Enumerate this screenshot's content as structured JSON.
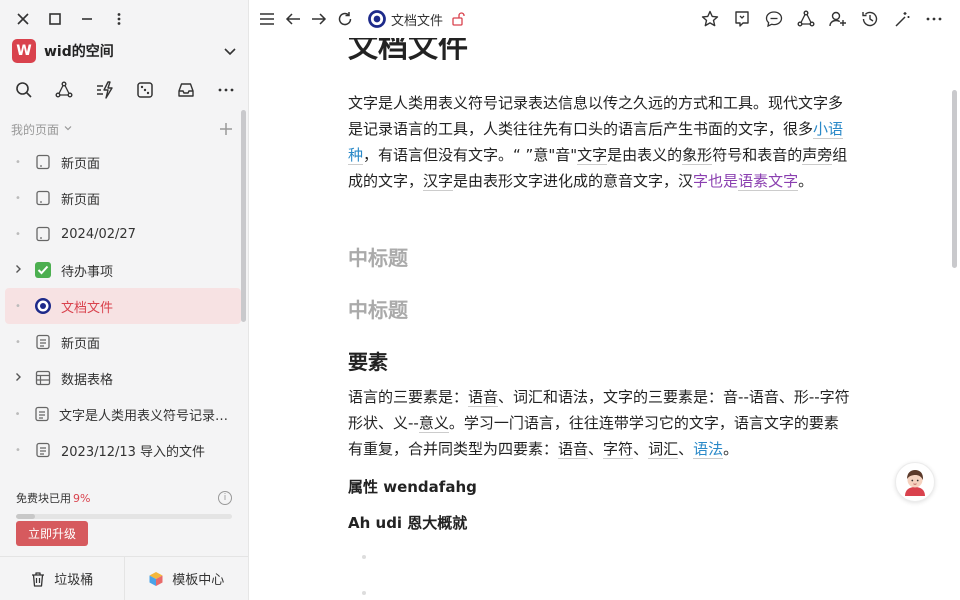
{
  "window": {
    "close": "close",
    "maximize": "maximize",
    "minimize": "minimize",
    "more": "more"
  },
  "space": {
    "avatar_letter": "W",
    "name": "wid的空间"
  },
  "sidebar": {
    "section_label": "我的页面",
    "items": [
      {
        "label": "新页面",
        "icon": "page-icon",
        "expandable": false,
        "active": false
      },
      {
        "label": "新页面",
        "icon": "page-icon",
        "expandable": false,
        "active": false
      },
      {
        "label": "2024/02/27",
        "icon": "page-icon",
        "expandable": false,
        "active": false
      },
      {
        "label": "待办事项",
        "icon": "checkbox-icon",
        "expandable": true,
        "active": false
      },
      {
        "label": "文档文件",
        "icon": "target-icon",
        "expandable": false,
        "active": true
      },
      {
        "label": "新页面",
        "icon": "doc-icon",
        "expandable": false,
        "active": false
      },
      {
        "label": "数据表格",
        "icon": "table-icon",
        "expandable": true,
        "active": false
      },
      {
        "label": "文字是人类用表义符号记录表达信息以传之久远的方式和工具",
        "icon": "doc-icon",
        "expandable": false,
        "active": false
      },
      {
        "label": "2023/12/13 导入的文件",
        "icon": "doc-icon",
        "expandable": false,
        "active": false
      }
    ],
    "quota": {
      "label": "免费块已用",
      "percent_text": "9%",
      "fraction": 0.09
    },
    "upgrade_label": "立即升级",
    "footer": {
      "trash_label": "垃圾桶",
      "templates_label": "模板中心"
    }
  },
  "topbar": {
    "doc_title": "文档文件"
  },
  "doc": {
    "title": "文档文件",
    "para1": {
      "a": "文字是人类用表义符号记录表达信息以传之久远的方式和工具。现代文字多是记录语言的工具，人类往往先有口头的语言后产生书面的文字，很多",
      "b": "小语种",
      "c": "，有语言但没有文字。“ ”意\"音\"",
      "d": "文字",
      "e": "是由表义的",
      "f": "象形",
      "g": "符号和表音的",
      "h": "声旁",
      "i": "组成的文字，",
      "j": "汉字",
      "k": "是由表形文字进化成的意音文字，汉",
      "l": "字也是",
      "m": "语素文字",
      "n": "。"
    },
    "h2a": "中标题",
    "h2b": "中标题",
    "h2c": "要素",
    "para2": {
      "a": "语言的三要素是：",
      "b": "语音",
      "c": "、词汇和语法，文字的三要素是：音--语音、形--字符形状、义--",
      "d": "意义",
      "e": "。学习一门语言，往往连带学习它的文字，语言文字的要素有重复，合并同类型为四要素：",
      "f": "语音",
      "g": "、",
      "h": "字符",
      "i": "、",
      "j": "词汇",
      "k": "、",
      "l": "语法",
      "m": "。"
    },
    "h3a": "属性 wendafahg",
    "h3b": "Ah udi 恩大概就"
  },
  "colors": {
    "brand": "#d9424d",
    "link_blue": "#2a89c8",
    "link_purple": "#8a3fb0",
    "active_bg": "#f7e2e3"
  }
}
